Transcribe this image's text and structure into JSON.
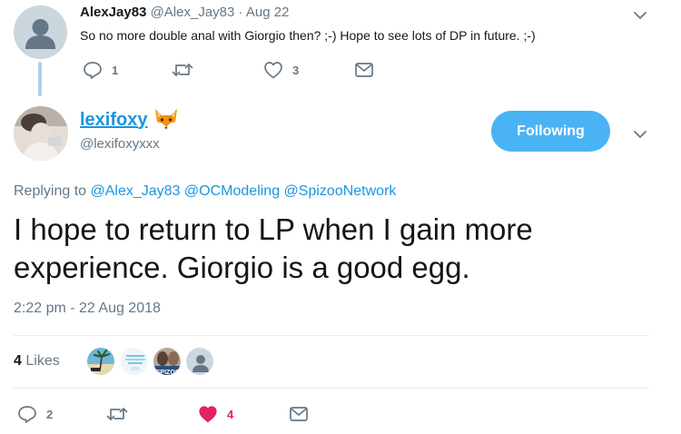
{
  "parent": {
    "name": "AlexJay83",
    "handle": "@Alex_Jay83",
    "date": "· Aug 22",
    "text": "So no more double anal with Giorgio then? ;-) Hope to see lots of DP in future. ;-)",
    "reply_count": "1",
    "retweet_count": "",
    "like_count": "3"
  },
  "tweet": {
    "display_name": "lexifoxy",
    "name_emoji_icon": "fox-face-icon",
    "handle": "@lexifoxyxxx",
    "follow_label": "Following",
    "replying_prefix": "Replying to",
    "mentions": [
      "@Alex_Jay83",
      "@OCModeling",
      "@SpizooNetwork"
    ],
    "text": "I hope to return to LP when I gain more experience. Giorgio is a good egg.",
    "timestamp": "2:22 pm - 22 Aug 2018",
    "likes_count": "4",
    "likes_label": "Likes",
    "likers": [
      "liker-beach-avatar",
      "liker-ocmodeling-avatar",
      "liker-spizoo-avatar",
      "liker-default-avatar"
    ],
    "reply_count": "2",
    "retweet_count": "",
    "like_count": "4"
  },
  "colors": {
    "accent": "#1b95e0",
    "follow_button": "#4ab3f4",
    "like_active": "#e0245e",
    "muted": "#657786",
    "thread_line": "#a9d3f3"
  }
}
